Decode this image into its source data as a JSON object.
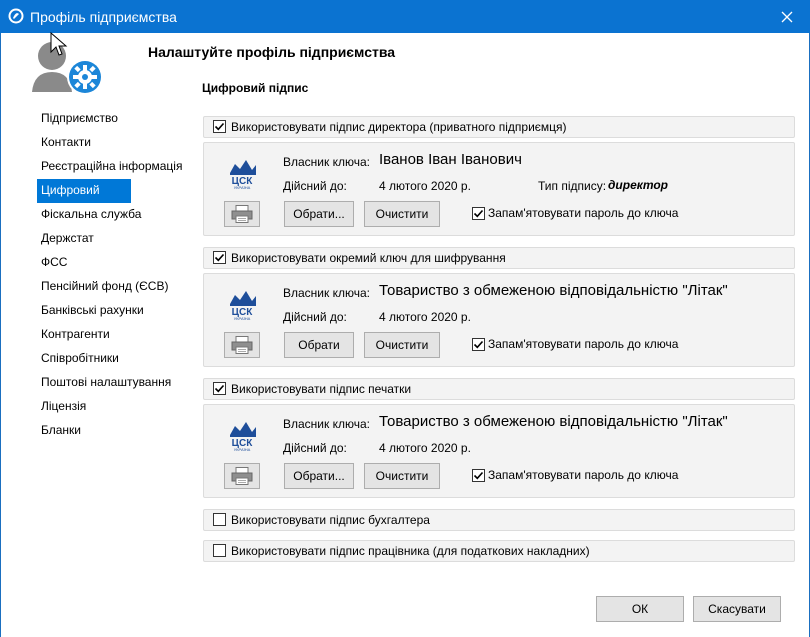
{
  "window": {
    "title": "Профіль підприємства"
  },
  "page": {
    "title": "Налаштуйте профіль підприємства",
    "section": "Цифровий підпис"
  },
  "nav": {
    "items": [
      {
        "label": "Підприємство"
      },
      {
        "label": "Контакти"
      },
      {
        "label": "Реєстраційна інформація"
      },
      {
        "label": "Цифровий підпис",
        "active": true
      },
      {
        "label": "Фіскальна служба"
      },
      {
        "label": "Держстат"
      },
      {
        "label": "ФСС"
      },
      {
        "label": "Пенсійний фонд (ЄСВ)"
      },
      {
        "label": "Банківські рахунки"
      },
      {
        "label": "Контрагенти"
      },
      {
        "label": "Співробітники"
      },
      {
        "label": "Поштові налаштування"
      },
      {
        "label": "Ліцензія"
      },
      {
        "label": "Бланки"
      }
    ]
  },
  "labels": {
    "owner": "Власник ключа:",
    "valid_until": "Дійсний до:",
    "sign_type": "Тип підпису:",
    "choose": "Обрати...",
    "choose_cut": "Обрати",
    "clear": "Очистити",
    "remember": "Запам'ятовувати пароль до ключа"
  },
  "director": {
    "checkbox_label": "Використовувати підпис директора (приватного підприємця)",
    "checked": true,
    "owner": "Іванов Іван Іванович",
    "valid_until": "4 лютого 2020 р.",
    "sign_type": "директор",
    "remember_checked": true
  },
  "encryption": {
    "checkbox_label": "Використовувати окремий ключ для шифрування",
    "checked": true,
    "owner": "Товариство з обмеженою відповідальністю \"Літак\"",
    "valid_until": "4 лютого 2020 р.",
    "remember_checked": true
  },
  "stamp": {
    "checkbox_label": "Використовувати підпис печатки",
    "checked": true,
    "owner": "Товариство з обмеженою відповідальністю \"Літак\"",
    "valid_until": "4 лютого 2020 р.",
    "remember_checked": true
  },
  "accountant": {
    "checkbox_label": "Використовувати підпис бухгалтера",
    "checked": false
  },
  "employee": {
    "checkbox_label": "Використовувати підпис працівника (для податкових накладних)",
    "checked": false
  },
  "footer": {
    "ok": "ОК",
    "cancel": "Скасувати"
  },
  "colors": {
    "titlebar": "#0b73d1",
    "accent": "#0078d7",
    "panel": "#f3f3f3",
    "logo": "#1e4e9a"
  }
}
